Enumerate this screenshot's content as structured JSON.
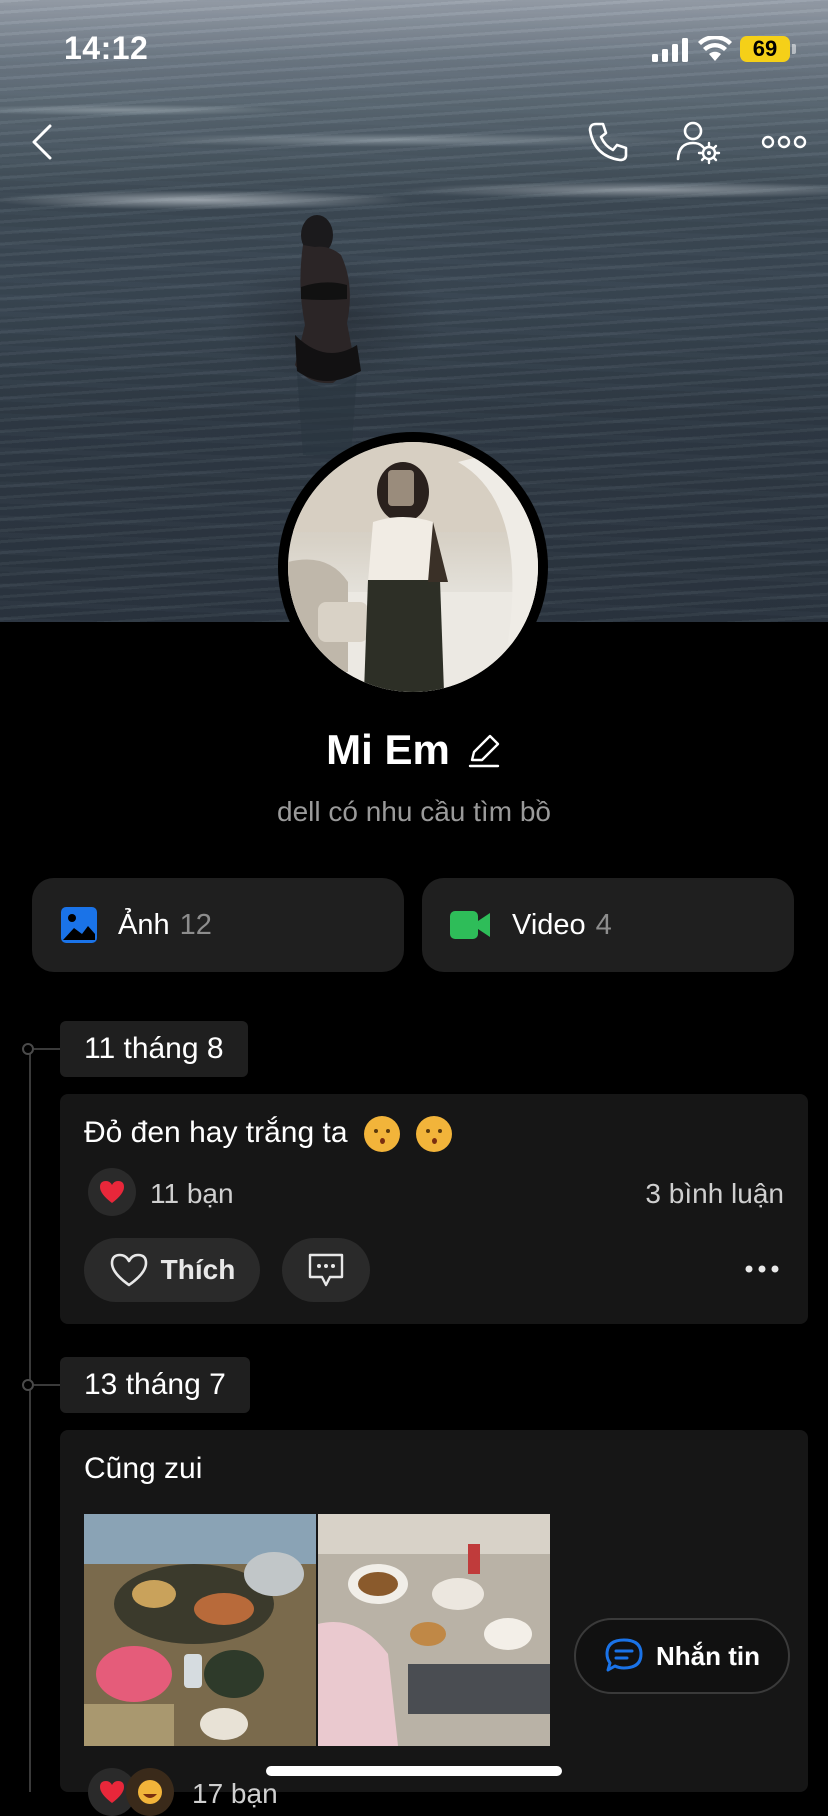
{
  "status_bar": {
    "time": "14:12",
    "battery": "69"
  },
  "profile": {
    "name": "Mi Em",
    "bio": "dell có nhu cầu tìm bồ"
  },
  "media": {
    "photos": {
      "label": "Ảnh",
      "count": "12"
    },
    "videos": {
      "label": "Video",
      "count": "4"
    }
  },
  "posts": [
    {
      "date": "11 tháng 8",
      "text": "Đỏ đen hay trắng ta",
      "reactions": "11 bạn",
      "comments": "3 bình luận",
      "like_label": "Thích"
    },
    {
      "date": "13 tháng 7",
      "text": "Cũng zui",
      "reactions": "17 bạn"
    }
  ],
  "message_button": {
    "label": "Nhắn tin"
  },
  "colors": {
    "background": "#000000",
    "card": "#161616",
    "accent_blue": "#1a73e8",
    "accent_green": "#2ebd59",
    "battery": "#f5d018"
  }
}
